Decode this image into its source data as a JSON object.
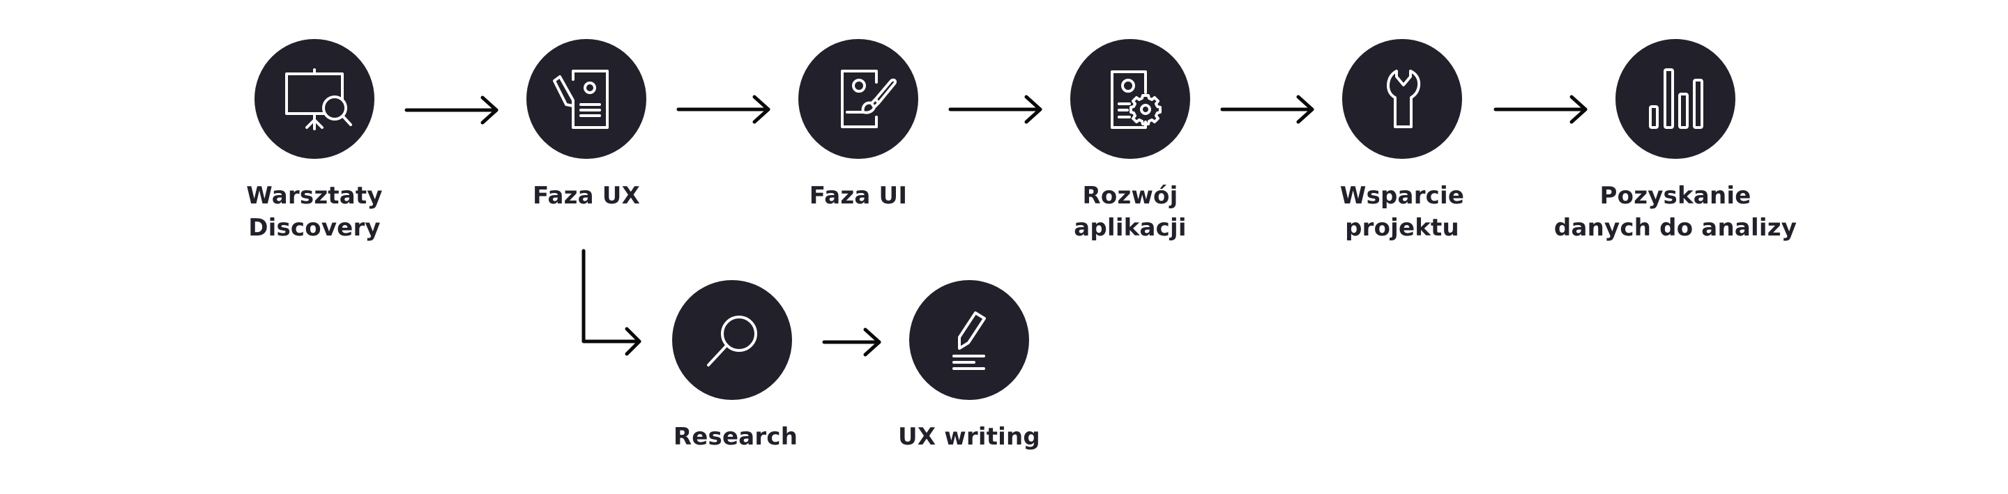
{
  "diagram": {
    "title": "",
    "colors": {
      "node_fill": "#22212b",
      "icon_stroke": "#ffffff",
      "arrow": "#0a0a0a",
      "text": "#22212b"
    },
    "main_flow": [
      {
        "id": "warsztaty",
        "icon": "presentation-board-magnifier-icon",
        "label_lines": [
          "Warsztaty",
          "Discovery"
        ]
      },
      {
        "id": "faza-ux",
        "icon": "document-pencil-icon",
        "label_lines": [
          "Faza UX"
        ]
      },
      {
        "id": "faza-ui",
        "icon": "phone-paintbrush-icon",
        "label_lines": [
          "Faza UI"
        ]
      },
      {
        "id": "rozwoj",
        "icon": "document-gear-icon",
        "label_lines": [
          "Rozwój",
          "aplikacji"
        ]
      },
      {
        "id": "wsparcie",
        "icon": "wrench-icon",
        "label_lines": [
          "Wsparcie",
          "projektu"
        ]
      },
      {
        "id": "pozyskanie",
        "icon": "bar-chart-icon",
        "label_lines": [
          "Pozyskanie",
          "danych do analizy"
        ]
      }
    ],
    "sub_flow": {
      "branches_from": "faza-ux",
      "steps": [
        {
          "id": "research",
          "icon": "magnifier-icon",
          "label_lines": [
            "Research"
          ]
        },
        {
          "id": "ux-writing",
          "icon": "pencil-lines-icon",
          "label_lines": [
            "UX writing"
          ]
        }
      ]
    },
    "edges": [
      {
        "from": "warsztaty",
        "to": "faza-ux"
      },
      {
        "from": "faza-ux",
        "to": "faza-ui"
      },
      {
        "from": "faza-ui",
        "to": "rozwoj"
      },
      {
        "from": "rozwoj",
        "to": "wsparcie"
      },
      {
        "from": "wsparcie",
        "to": "pozyskanie"
      },
      {
        "from": "faza-ux",
        "to": "research"
      },
      {
        "from": "research",
        "to": "ux-writing"
      }
    ]
  }
}
